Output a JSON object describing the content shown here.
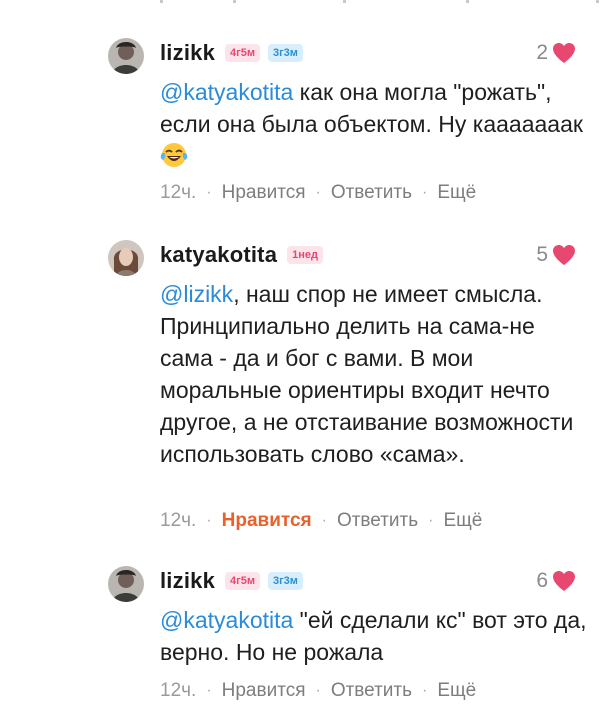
{
  "comments": [
    {
      "username": "lizikk",
      "badges": [
        {
          "text": "4г5м",
          "color": "pink"
        },
        {
          "text": "3г3м",
          "color": "blue"
        }
      ],
      "likes": "2",
      "mention": "@katyakotita",
      "text": " как она могла \"рожать\", если она была объектом. Ну кааааааак",
      "emoji": "face-with-tears-of-joy-icon",
      "time": "12ч.",
      "like_label": "Нравится",
      "liked": false,
      "reply_label": "Ответить",
      "more_label": "Ещё"
    },
    {
      "username": "katyakotita",
      "badges": [
        {
          "text": "1нед",
          "color": "pink"
        }
      ],
      "likes": "5",
      "mention": "@lizikk",
      "text": ", наш спор не имеет смысла. Принципиально делить на сама-не сама - да и бог с вами. В мои моральные ориентиры входит нечто другое, а не отстаивание возможности использовать слово «сама».",
      "time": "12ч.",
      "like_label": "Нравится",
      "liked": true,
      "reply_label": "Ответить",
      "more_label": "Ещё"
    },
    {
      "username": "lizikk",
      "badges": [
        {
          "text": "4г5м",
          "color": "pink"
        },
        {
          "text": "3г3м",
          "color": "blue"
        }
      ],
      "likes": "6",
      "mention": "@katyakotita",
      "text": " \"ей сделали кс\" вот это да, верно. Но не рожала",
      "time": "12ч.",
      "like_label": "Нравится",
      "liked": false,
      "reply_label": "Ответить",
      "more_label": "Ещё"
    }
  ],
  "colors": {
    "heart": "#e8476f",
    "mention": "#2a8bd8",
    "liked": "#e8602c"
  }
}
